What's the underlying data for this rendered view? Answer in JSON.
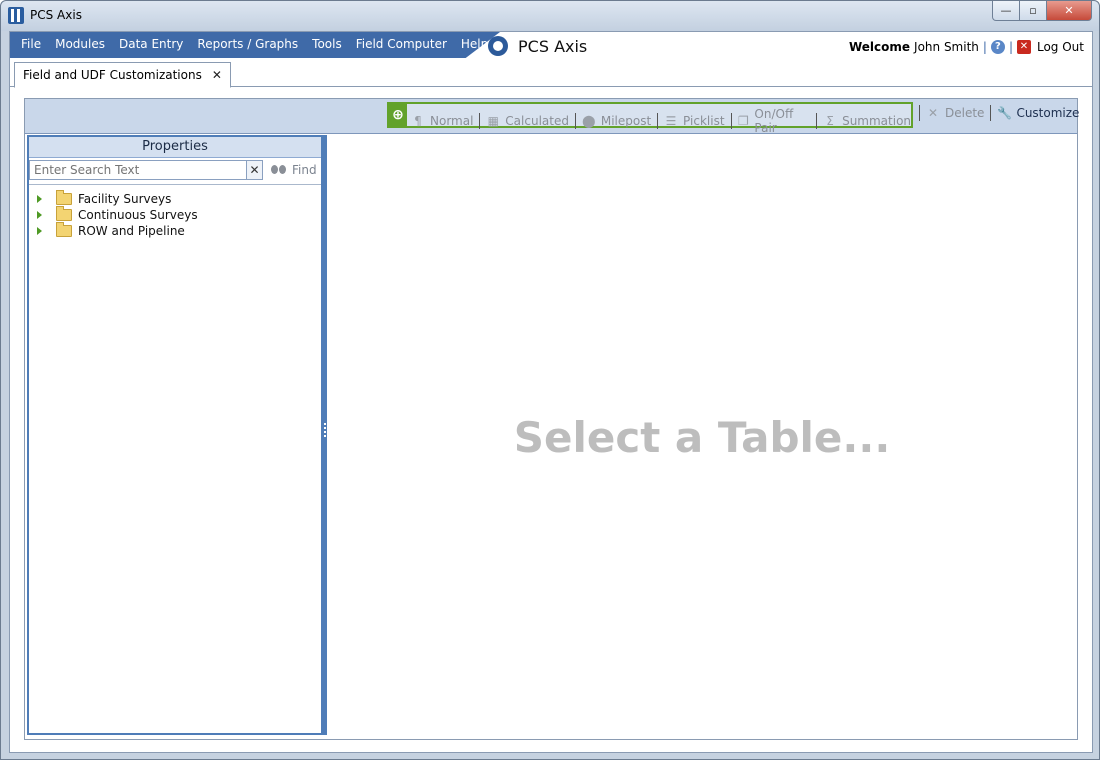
{
  "window": {
    "title": "PCS Axis",
    "controls": {
      "minimize": "—",
      "maximize": "▫",
      "close": "✕"
    }
  },
  "menubar": {
    "items": [
      "File",
      "Modules",
      "Data Entry",
      "Reports / Graphs",
      "Tools",
      "Field Computer",
      "Help"
    ],
    "brand": "PCS Axis",
    "welcome_label": "Welcome",
    "user_name": "John Smith",
    "logout_label": "Log Out"
  },
  "tabs": [
    {
      "label": "Field and UDF Customizations",
      "close": "✕"
    }
  ],
  "toolbar": {
    "add_icon": "plus-circle-icon",
    "buttons": [
      {
        "label": "Normal",
        "icon": "normal-field-icon",
        "glyph": "¶"
      },
      {
        "label": "Calculated",
        "icon": "calculator-icon",
        "glyph": "▦"
      },
      {
        "label": "Milepost",
        "icon": "map-pin-icon",
        "glyph": "⬤"
      },
      {
        "label": "Picklist",
        "icon": "picklist-icon",
        "glyph": "☰"
      },
      {
        "label": "On/Off Pair",
        "icon": "on-off-pair-icon",
        "glyph": "❐"
      },
      {
        "label": "Summation",
        "icon": "sigma-icon",
        "glyph": "Σ"
      }
    ],
    "delete_label": "Delete",
    "customize_label": "Customize"
  },
  "properties": {
    "header": "Properties",
    "search_placeholder": "Enter Search Text",
    "clear": "✕",
    "find_label": "Find",
    "tree": [
      "Facility Surveys",
      "Continuous Surveys",
      "ROW and Pipeline"
    ]
  },
  "main": {
    "placeholder": "Select a Table..."
  },
  "colors": {
    "menu_blue": "#3f6aa8",
    "highlight_green": "#62a22b",
    "panel_border": "#4f7db8"
  }
}
